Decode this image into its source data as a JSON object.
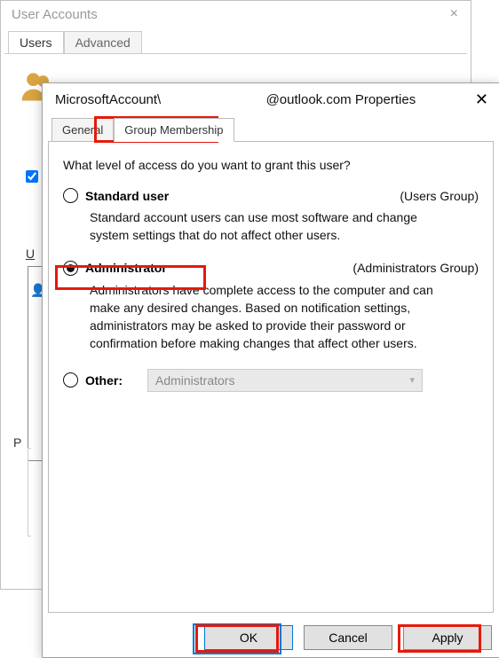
{
  "bgWindow": {
    "title": "User Accounts",
    "closeLabel": "×",
    "tabs": {
      "users": "Users",
      "advanced": "Advanced"
    },
    "checkboxLabel": "",
    "underlineU": "U",
    "pLetter": "P"
  },
  "fgWindow": {
    "titlePrefix": "MicrosoftAccount\\",
    "titleSuffix": "@outlook.com Properties",
    "closeLabel": "✕",
    "tabs": {
      "general": "General",
      "groupMembership": "Group Membership"
    },
    "question": "What level of access do you want to grant this user?",
    "options": {
      "standard": {
        "label": "Standard user",
        "group": "(Users Group)",
        "desc": "Standard account users can use most software and change system settings that do not affect other users."
      },
      "admin": {
        "label": "Administrator",
        "group": "(Administrators Group)",
        "desc": "Administrators have complete access to the computer and can make any desired changes. Based on notification settings, administrators may be asked to provide their password or confirmation before making changes that affect other users."
      },
      "other": {
        "label": "Other:",
        "selected": "Administrators"
      }
    },
    "buttons": {
      "ok": "OK",
      "cancel": "Cancel",
      "apply": "Apply"
    }
  }
}
